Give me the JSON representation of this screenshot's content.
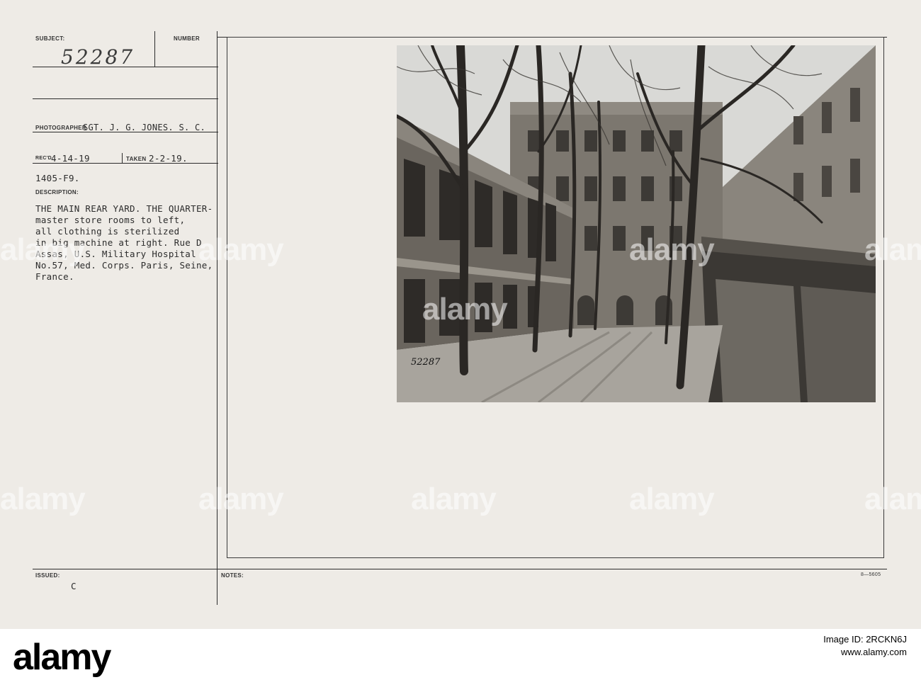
{
  "card": {
    "subject_label": "SUBJECT:",
    "number_label": "NUMBER",
    "subject_number": "52287",
    "photographer_label": "PHOTOGRAPHER",
    "photographer": "SGT. J. G. JONES. S. C.",
    "recd_label": "REC'D",
    "recd_date": "4-14-19",
    "taken_label": "TAKEN",
    "taken_date": "2-2-19.",
    "file_code": "1405-F9.",
    "description_label": "DESCRIPTION:",
    "description_lines": [
      "THE MAIN REAR YARD. THE QUARTER-",
      "master store rooms to left,",
      "all clothing is sterilized",
      "in big machine at right. Rue D",
      "Assas, U.S. Military Hospital",
      "No.57, Med. Corps. Paris, Seine,",
      "France."
    ],
    "issued_label": "ISSUED:",
    "issued_value": "C",
    "notes_label": "NOTES:",
    "form_code": "8—5605",
    "photo_number": "52287"
  },
  "watermark": "alamy",
  "footer": {
    "logo": "alamy",
    "image_id_label": "Image ID: 2RCKN6J",
    "site": "www.alamy.com"
  },
  "colors": {
    "card": "#eeebe6",
    "ink": "#2c2c2c",
    "footer_bg": "#ffffff"
  }
}
